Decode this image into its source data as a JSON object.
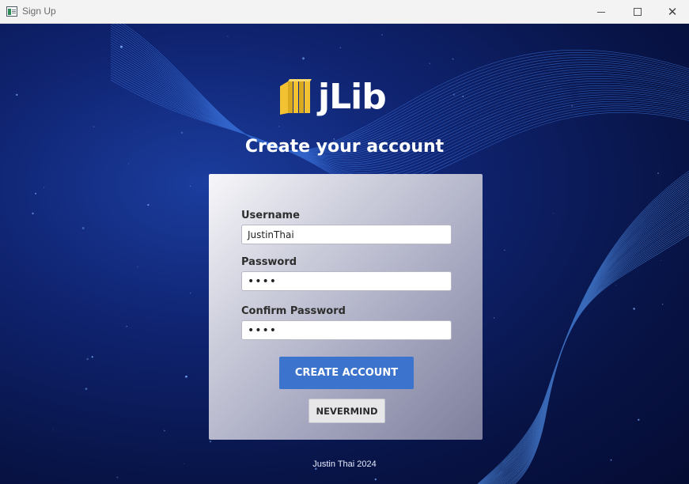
{
  "window": {
    "title": "Sign Up",
    "controls": [
      "minimize",
      "maximize",
      "close"
    ]
  },
  "logo": {
    "text": "jLib",
    "icon": "books-icon"
  },
  "heading": "Create your account",
  "form": {
    "username": {
      "label": "Username",
      "value": "JustinThai"
    },
    "password": {
      "label": "Password",
      "value": "••••"
    },
    "confirm_password": {
      "label": "Confirm Password",
      "value": "••••"
    }
  },
  "buttons": {
    "create": "CREATE ACCOUNT",
    "nevermind": "NEVERMIND"
  },
  "footer": "Justin Thai 2024",
  "colors": {
    "background": "#0a1445",
    "primary_button": "#3c73cc",
    "logo_accent": "#f2c233"
  }
}
